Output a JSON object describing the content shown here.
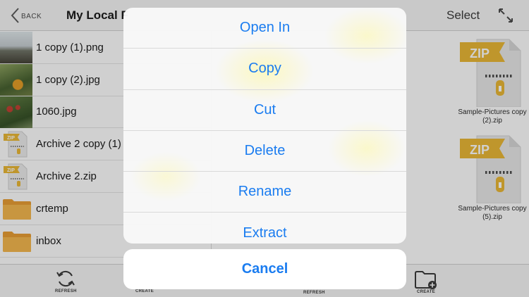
{
  "left_nav": {
    "back_label": "BACK",
    "title": "My Local F"
  },
  "files": [
    {
      "name": "1 copy (1).png",
      "kind": "image"
    },
    {
      "name": "1 copy (2).jpg",
      "kind": "image"
    },
    {
      "name": "1060.jpg",
      "kind": "image"
    },
    {
      "name": "Archive 2 copy (1)",
      "kind": "zip"
    },
    {
      "name": "Archive 2.zip",
      "kind": "zip"
    },
    {
      "name": "crtemp",
      "kind": "folder"
    },
    {
      "name": "inbox",
      "kind": "folder"
    }
  ],
  "left_toolbar": {
    "refresh_label": "REFRESH",
    "create_label": "CREATE"
  },
  "right_nav": {
    "select_label": "Select"
  },
  "grid": [
    {
      "caption_line1": "Sample-Pictures copy",
      "caption_line2": "(2).zip",
      "icon": "zip-file-icon"
    },
    {
      "caption_line1": "Sample-Pictures copy",
      "caption_line2": "(5).zip",
      "icon": "zip-file-icon"
    }
  ],
  "zip_badge": "ZIP",
  "right_toolbar": {
    "refresh_label": "REFRESH",
    "create_label": "CREATE"
  },
  "action_sheet": {
    "items": [
      "Open In",
      "Copy",
      "Cut",
      "Delete",
      "Rename",
      "Extract"
    ],
    "cancel_label": "Cancel"
  },
  "colors": {
    "accent": "#1a7cf0",
    "folder": "#f0a83a",
    "zip_banner": "#eab52e"
  }
}
